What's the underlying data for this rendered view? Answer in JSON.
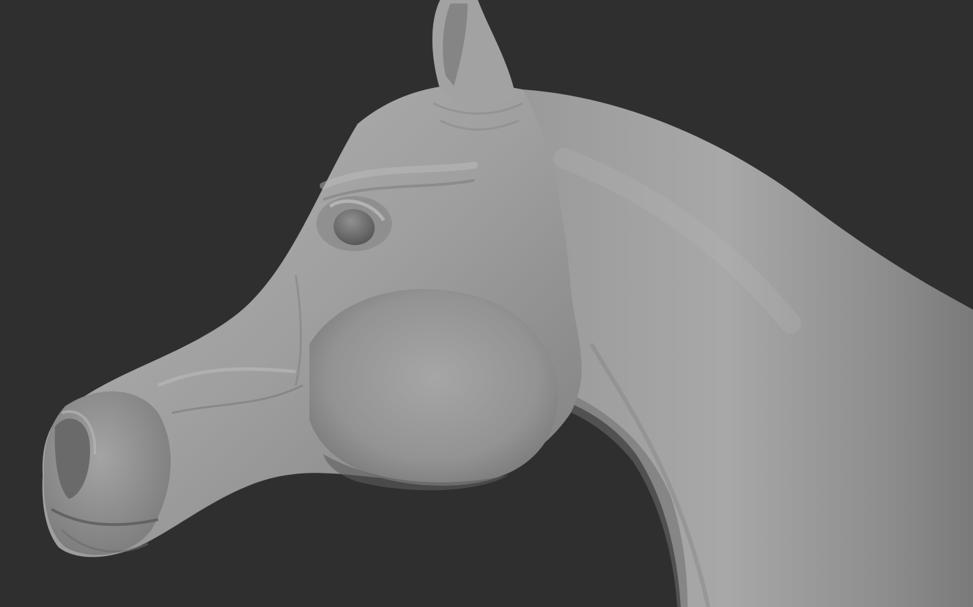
{
  "scene": {
    "subject": "horse-head-sculpt",
    "colors": {
      "background": "#2f2f2f",
      "clay_light": "#a9a9a9",
      "clay_mid": "#8c8c8c",
      "clay_dark": "#5e5e5e",
      "eye": "#6f6f6f"
    }
  }
}
